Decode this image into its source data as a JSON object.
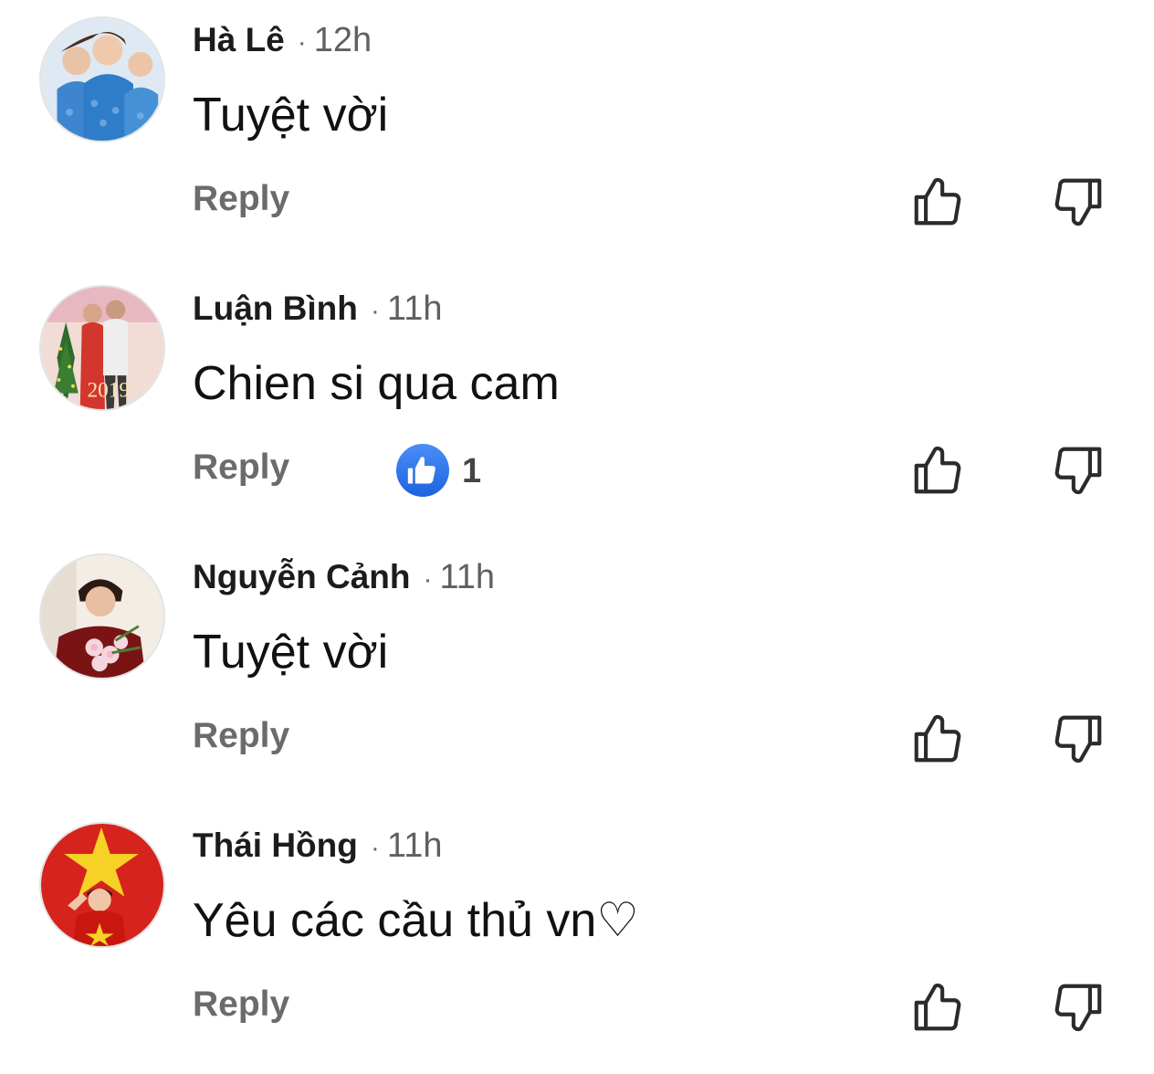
{
  "comments": [
    {
      "author": "Hà Lê",
      "separator": "·",
      "time": "12h",
      "text": "Tuyệt vời",
      "reply_label": "Reply"
    },
    {
      "author": "Luận Bình",
      "separator": "·",
      "time": "11h",
      "text": "Chien si qua cam",
      "reply_label": "Reply",
      "like_count": "1",
      "avatar_text": "2019"
    },
    {
      "author": "Nguyễn Cảnh",
      "separator": "·",
      "time": "11h",
      "text": "Tuyệt vời",
      "reply_label": "Reply"
    },
    {
      "author": "Thái Hồng",
      "separator": "·",
      "time": "11h",
      "text": "Yêu các cầu thủ vn♡",
      "reply_label": "Reply"
    }
  ],
  "icons": {
    "like": "thumbs-up-icon",
    "dislike": "thumbs-down-icon",
    "reaction": "like-reaction-icon"
  },
  "colors": {
    "reaction_blue": "#1d63e0",
    "muted_text": "#6b6b6b",
    "icon_stroke": "#2b2b2b"
  }
}
